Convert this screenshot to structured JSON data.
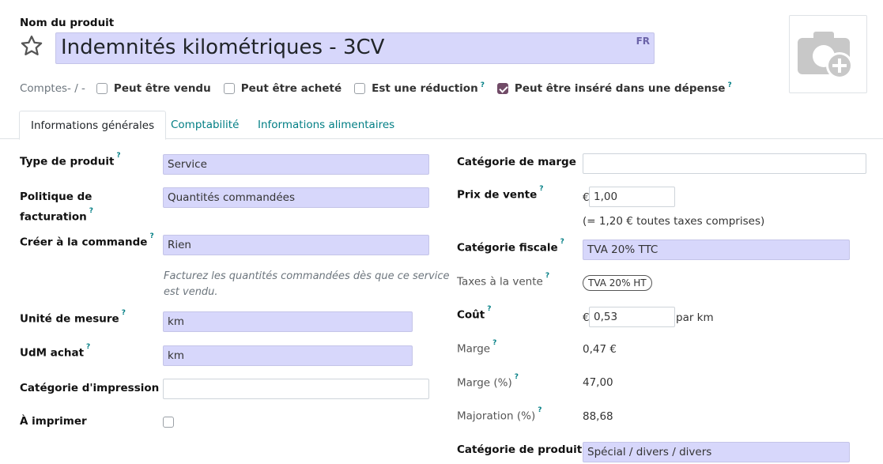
{
  "header": {
    "name_label": "Nom du produit",
    "product_name": "Indemnités kilométriques - 3CV",
    "lang_badge": "FR",
    "accounts_text": "Comptes- / -"
  },
  "flags": [
    {
      "label": "Peut être vendu",
      "checked": false,
      "help": false
    },
    {
      "label": "Peut être acheté",
      "checked": false,
      "help": false
    },
    {
      "label": "Est une réduction",
      "checked": false,
      "help": true
    },
    {
      "label": "Peut être inséré dans une dépense",
      "checked": true,
      "help": true
    }
  ],
  "help_mark": "?",
  "tabs": [
    {
      "label": "Informations générales",
      "active": true
    },
    {
      "label": "Comptabilité",
      "active": false
    },
    {
      "label": "Informations alimentaires",
      "active": false
    }
  ],
  "left": {
    "type_label": "Type de produit",
    "type_value": "Service",
    "policy_label_1": "Politique de",
    "policy_label_2": "facturation",
    "policy_value": "Quantités commandées",
    "create_label": "Créer à la commande",
    "create_value": "Rien",
    "hint_1": "Facturez les quantités commandées dès que ce service",
    "hint_2": "est vendu.",
    "uom_label": "Unité de mesure",
    "uom_value": "km",
    "uom_po_label": "UdM achat",
    "uom_po_value": "km",
    "print_cat_label": "Catégorie d'impression",
    "print_cat_value": "",
    "to_print_label": "À imprimer"
  },
  "right": {
    "margin_cat_label": "Catégorie de marge",
    "margin_cat_value": "",
    "price_label": "Prix de vente",
    "currency": "€",
    "price_value": "1,00",
    "price_tax_note": "(= 1,20 € toutes taxes comprises)",
    "fiscal_label": "Catégorie fiscale",
    "fiscal_value": "TVA 20% TTC",
    "taxes_label": "Taxes à la vente",
    "tax_tag": "TVA 20% HT",
    "cost_label": "Coût",
    "cost_value": "0,53",
    "cost_unit": "par km",
    "margin_label": "Marge",
    "margin_value": "0,47 €",
    "margin_pct_label": "Marge (%)",
    "margin_pct_value": "47,00",
    "markup_label": "Majoration (%)",
    "markup_value": "88,68",
    "product_cat_label": "Catégorie de produit",
    "product_cat_value": "Spécial / divers / divers"
  },
  "colors": {
    "accent": "#714b67",
    "link": "#017e84",
    "required_bg": "#d7d7fb"
  }
}
